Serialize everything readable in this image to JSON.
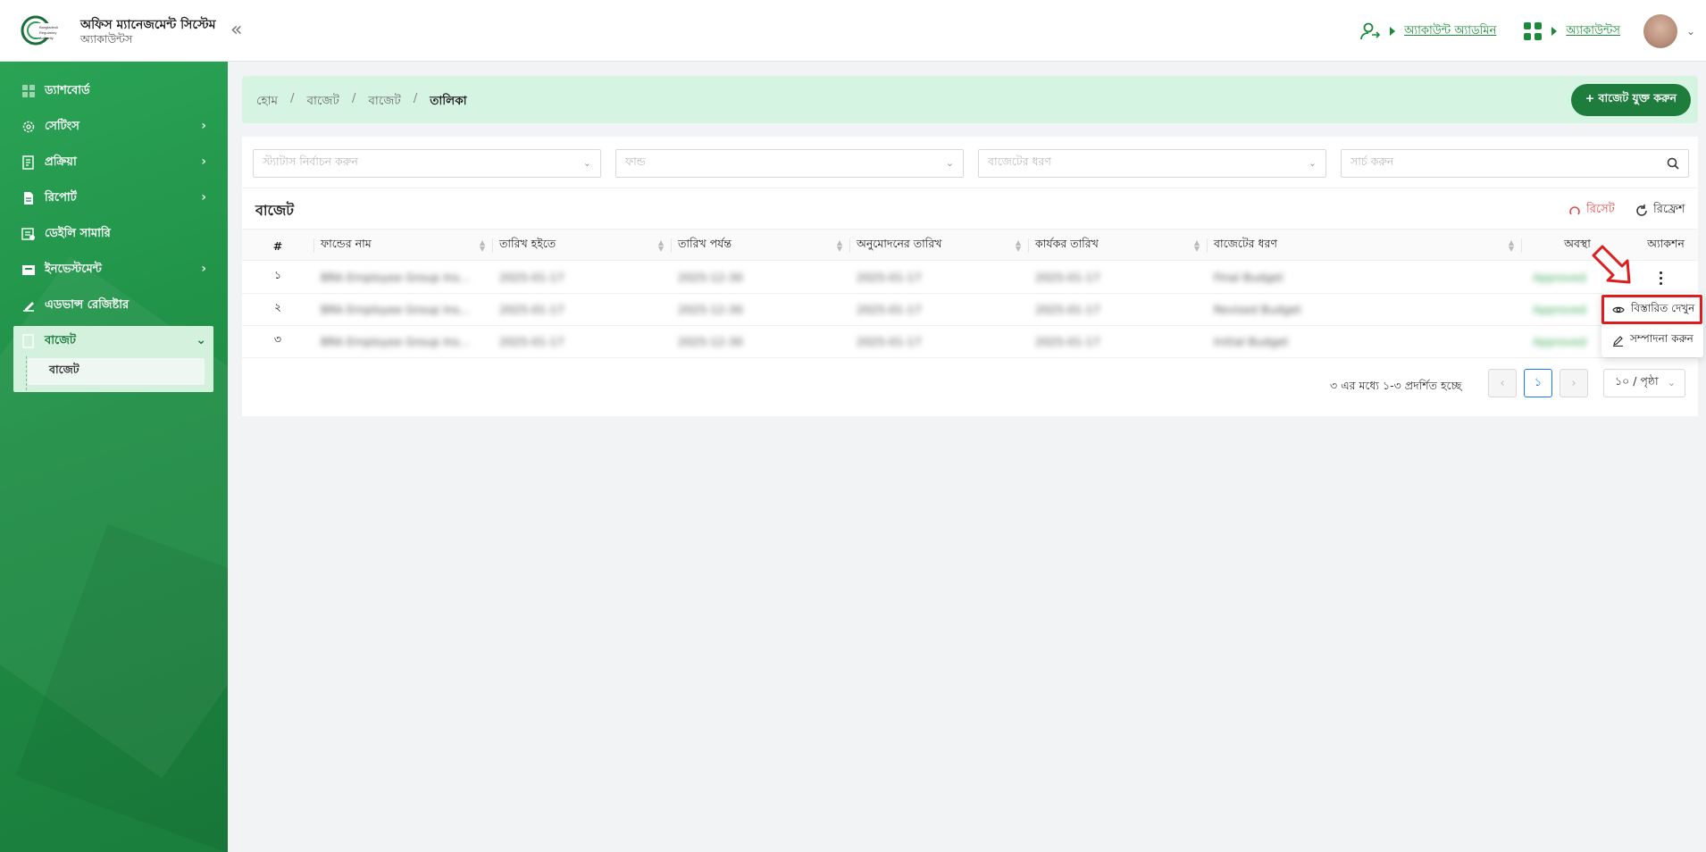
{
  "header": {
    "app_title": "অফিস ম্যানেজমেন্ট সিস্টেম",
    "app_subtitle": "অ্যাকাউন্টস",
    "logo_text": "Bangladesh Regulatory Authority",
    "admin_link": "অ্যাকাউন্ট অ্যাডমিন",
    "module_link": "অ্যাকাউন্টস",
    "collapse_icon": "double-chevron-left-icon"
  },
  "sidebar": {
    "items": [
      {
        "label": "ড্যাশবোর্ড",
        "icon": "dashboard-icon",
        "has_children": false
      },
      {
        "label": "সেটিংস",
        "icon": "gear-icon",
        "has_children": true
      },
      {
        "label": "প্রক্রিয়া",
        "icon": "process-icon",
        "has_children": true
      },
      {
        "label": "রিপোর্ট",
        "icon": "report-icon",
        "has_children": true
      },
      {
        "label": "ডেইলি সামারি",
        "icon": "summary-icon",
        "has_children": false
      },
      {
        "label": "ইনভেস্টমেন্ট",
        "icon": "investment-icon",
        "has_children": true
      },
      {
        "label": "এডভান্স রেজিষ্টার",
        "icon": "register-icon",
        "has_children": false
      }
    ],
    "open_group": {
      "label": "বাজেট",
      "icon": "budget-icon",
      "sub_items": [
        {
          "label": "বাজেট"
        }
      ]
    }
  },
  "breadcrumb": {
    "items": [
      "হোম",
      "বাজেট",
      "বাজেট"
    ],
    "current": "তালিকা",
    "separator": "/"
  },
  "add_button": "+ বাজেট যুক্ত করুন",
  "filters": {
    "status_placeholder": "স্ট্যাটাস নির্বাচন করুন",
    "fund_placeholder": "ফান্ড",
    "budget_type_placeholder": "বাজেটের ধরণ",
    "search_placeholder": "সার্চ করুন"
  },
  "table": {
    "title": "বাজেট",
    "reset_label": "রিসেট",
    "refresh_label": "রিফ্রেশ",
    "columns": [
      "#",
      "ফান্ডের নাম",
      "তারিখ হইতে",
      "তারিখ পর্যন্ত",
      "অনুমোদনের তারিখ",
      "কার্যকর তারিখ",
      "বাজেটের ধরণ",
      "অবস্থা",
      "অ্যাকশন"
    ],
    "rows": [
      {
        "sl": "১",
        "fund": "BRA Employee Group Ins...",
        "from": "2025-01-17",
        "to": "2025-12-30",
        "approval": "2025-01-17",
        "effective": "2025-01-17",
        "type": "Final Budget",
        "status": "Approved"
      },
      {
        "sl": "২",
        "fund": "BRA Employee Group Ins...",
        "from": "2025-01-17",
        "to": "2025-12-30",
        "approval": "2025-01-17",
        "effective": "2025-01-17",
        "type": "Revised Budget",
        "status": "Approved"
      },
      {
        "sl": "৩",
        "fund": "BRA Employee Group Ins...",
        "from": "2025-01-17",
        "to": "2025-12-30",
        "approval": "2025-01-17",
        "effective": "2025-01-17",
        "type": "Initial Budget",
        "status": "Approved"
      }
    ]
  },
  "pagination": {
    "info": "৩ এর মধ্যে ১-৩ প্রদর্শিত হচ্ছে",
    "current_page": "১",
    "page_size": "১০ / পৃষ্ঠা"
  },
  "action_menu": {
    "view_label": "বিস্তারিত দেখুন",
    "edit_label": "সম্পাদনা করুন"
  },
  "colors": {
    "primary": "#1e7d3d",
    "sidebar": "#1f8f46",
    "breadcrumb_bg": "#d5f4e2",
    "reset": "#e24848",
    "highlight": "#e01b1b"
  }
}
